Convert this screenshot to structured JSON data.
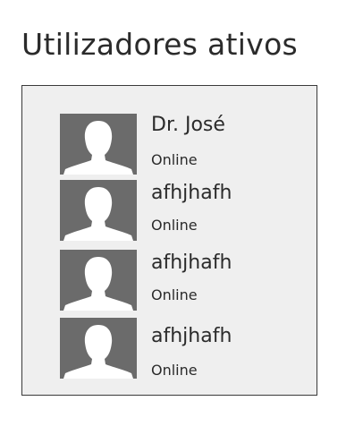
{
  "page": {
    "title": "Utilizadores ativos"
  },
  "users": [
    {
      "name": "Dr. José",
      "status": "Online",
      "avatar_icon": "person-silhouette-icon"
    },
    {
      "name": "afhjhafh",
      "status": "Online",
      "avatar_icon": "person-silhouette-icon"
    },
    {
      "name": "afhjhafh",
      "status": "Online",
      "avatar_icon": "person-silhouette-icon"
    },
    {
      "name": "afhjhafh",
      "status": "Online",
      "avatar_icon": "person-silhouette-icon"
    }
  ],
  "colors": {
    "panel_background": "#efefef",
    "panel_border": "#3a3a3a",
    "avatar_background": "#6b6b6b",
    "avatar_silhouette": "#ffffff",
    "text": "#2b2b2b"
  }
}
